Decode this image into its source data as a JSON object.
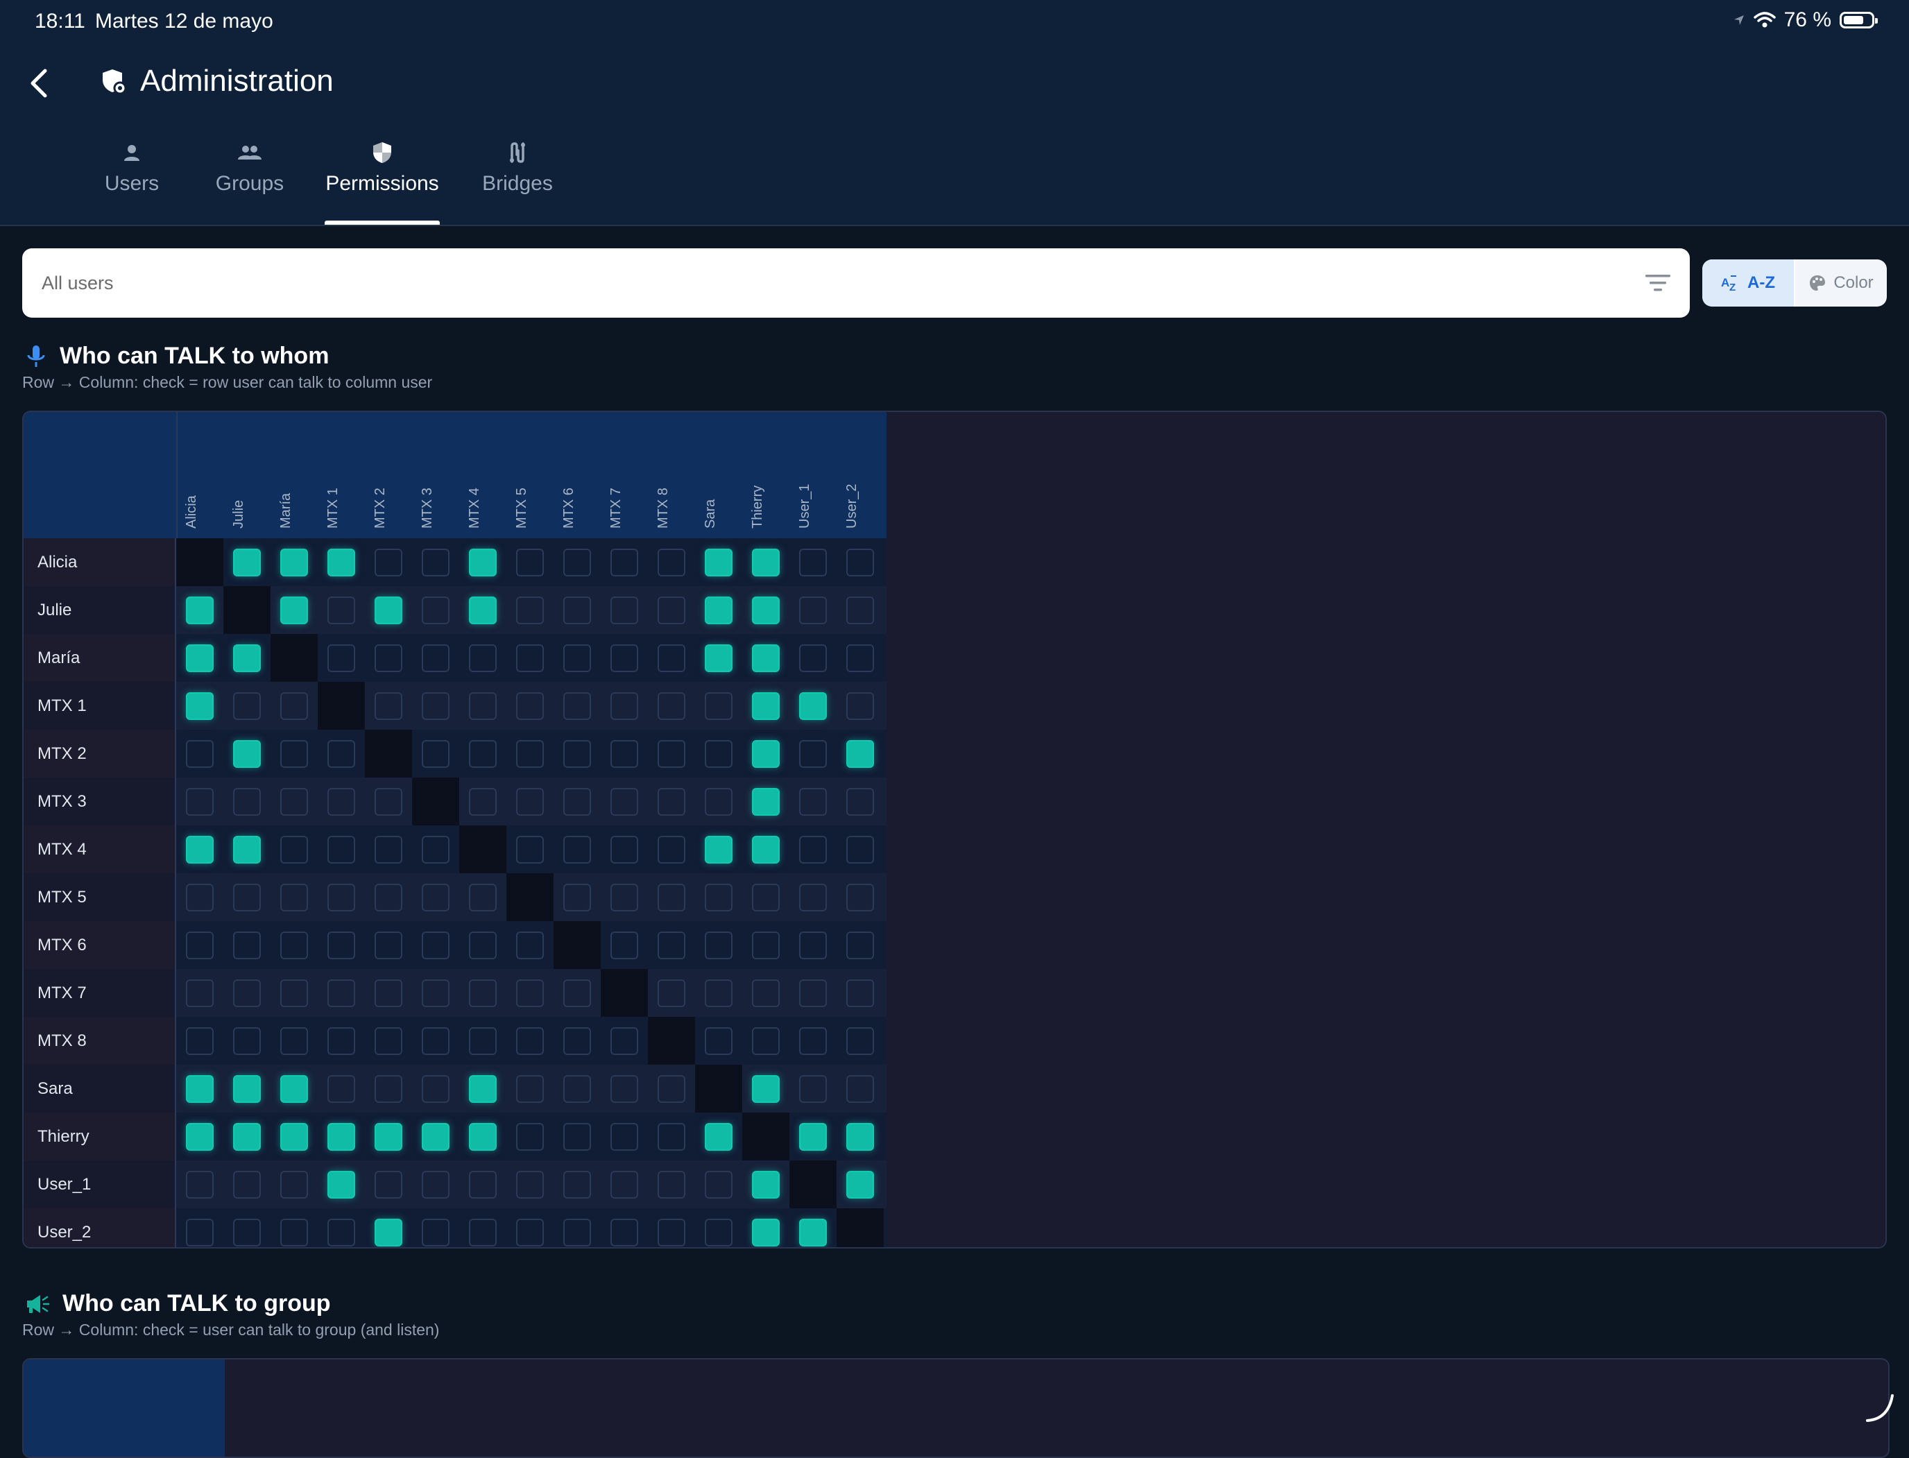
{
  "status_bar": {
    "time": "18:11",
    "date": "Martes 12 de mayo",
    "battery": "76 %"
  },
  "header": {
    "title": "Administration"
  },
  "tabs": [
    {
      "label": "Users",
      "icon": "person-icon"
    },
    {
      "label": "Groups",
      "icon": "people-icon"
    },
    {
      "label": "Permissions",
      "icon": "shield-icon",
      "active": true
    },
    {
      "label": "Bridges",
      "icon": "bridge-icon"
    }
  ],
  "filter": {
    "placeholder": "All users"
  },
  "sort": {
    "az_label": "A-Z",
    "color_label": "Color",
    "selected": "A-Z"
  },
  "talk_matrix": {
    "title": "Who can TALK to whom",
    "subtitle": "Row → Column: check = row user can talk to column user",
    "users": [
      "Alicia",
      "Julie",
      "María",
      "MTX 1",
      "MTX 2",
      "MTX 3",
      "MTX 4",
      "MTX 5",
      "MTX 6",
      "MTX 7",
      "MTX 8",
      "Sara",
      "Thierry",
      "User_1",
      "User_2"
    ],
    "checked": [
      [
        0,
        1,
        1,
        1,
        0,
        0,
        1,
        0,
        0,
        0,
        0,
        1,
        1,
        0,
        0
      ],
      [
        1,
        0,
        1,
        0,
        1,
        0,
        1,
        0,
        0,
        0,
        0,
        1,
        1,
        0,
        0
      ],
      [
        1,
        1,
        0,
        0,
        0,
        0,
        0,
        0,
        0,
        0,
        0,
        1,
        1,
        0,
        0
      ],
      [
        1,
        0,
        0,
        0,
        0,
        0,
        0,
        0,
        0,
        0,
        0,
        0,
        1,
        1,
        0
      ],
      [
        0,
        1,
        0,
        0,
        0,
        0,
        0,
        0,
        0,
        0,
        0,
        0,
        1,
        0,
        1
      ],
      [
        0,
        0,
        0,
        0,
        0,
        0,
        0,
        0,
        0,
        0,
        0,
        0,
        1,
        0,
        0
      ],
      [
        1,
        1,
        0,
        0,
        0,
        0,
        0,
        0,
        0,
        0,
        0,
        1,
        1,
        0,
        0
      ],
      [
        0,
        0,
        0,
        0,
        0,
        0,
        0,
        0,
        0,
        0,
        0,
        0,
        0,
        0,
        0
      ],
      [
        0,
        0,
        0,
        0,
        0,
        0,
        0,
        0,
        0,
        0,
        0,
        0,
        0,
        0,
        0
      ],
      [
        0,
        0,
        0,
        0,
        0,
        0,
        0,
        0,
        0,
        0,
        0,
        0,
        0,
        0,
        0
      ],
      [
        0,
        0,
        0,
        0,
        0,
        0,
        0,
        0,
        0,
        0,
        0,
        0,
        0,
        0,
        0
      ],
      [
        1,
        1,
        1,
        0,
        0,
        0,
        1,
        0,
        0,
        0,
        0,
        0,
        1,
        0,
        0
      ],
      [
        1,
        1,
        1,
        1,
        1,
        1,
        1,
        0,
        0,
        0,
        0,
        1,
        0,
        1,
        1
      ],
      [
        0,
        0,
        0,
        1,
        0,
        0,
        0,
        0,
        0,
        0,
        0,
        0,
        1,
        0,
        1
      ],
      [
        0,
        0,
        0,
        0,
        1,
        0,
        0,
        0,
        0,
        0,
        0,
        0,
        1,
        1,
        0
      ]
    ]
  },
  "group_matrix": {
    "title": "Who can TALK to group",
    "subtitle": "Row → Column: check = user can talk to group (and listen)"
  },
  "colors": {
    "accent": "#10bca6",
    "header_bg": "#0f2138",
    "tab_active": "#ffffff",
    "matrix_header": "#0f305e"
  }
}
